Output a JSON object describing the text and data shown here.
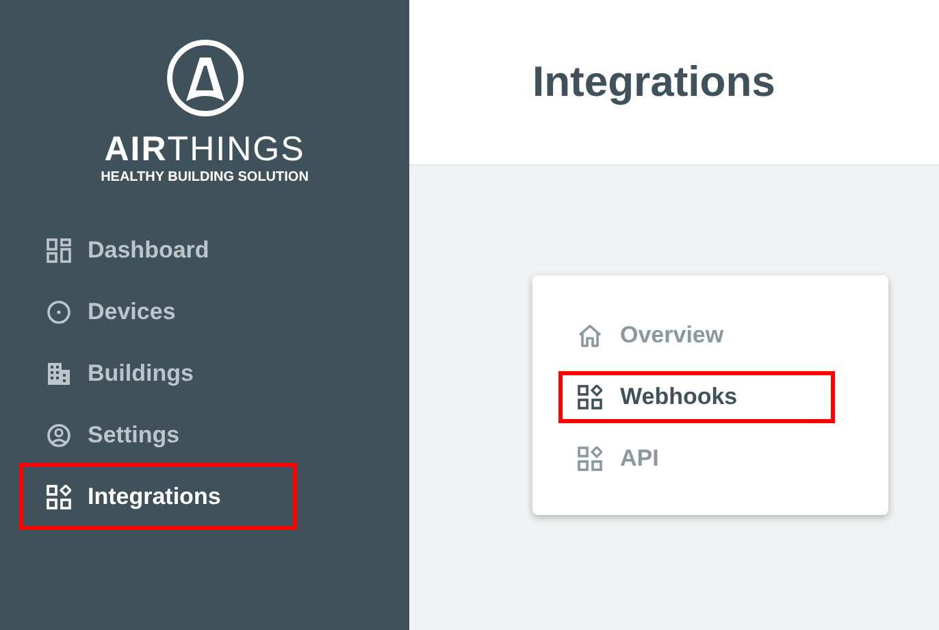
{
  "sidebar": {
    "logo": {
      "wordmark": "**AIR**THINGS",
      "tagline": "HEALTHY BUILDING SOLUTION"
    },
    "items": [
      {
        "label": "Dashboard",
        "selected": false,
        "highlighted": false
      },
      {
        "label": "Devices",
        "selected": false,
        "highlighted": false
      },
      {
        "label": "Buildings",
        "selected": false,
        "highlighted": false
      },
      {
        "label": "Settings",
        "selected": false,
        "highlighted": false
      },
      {
        "label": "Integrations",
        "selected": true,
        "highlighted": true
      }
    ]
  },
  "header": {
    "title": "Integrations"
  },
  "submenu": {
    "items": [
      {
        "label": "Overview",
        "selected": false,
        "highlighted": false
      },
      {
        "label": "Webhooks",
        "selected": true,
        "highlighted": true
      },
      {
        "label": "API",
        "selected": false,
        "highlighted": false
      }
    ]
  }
}
